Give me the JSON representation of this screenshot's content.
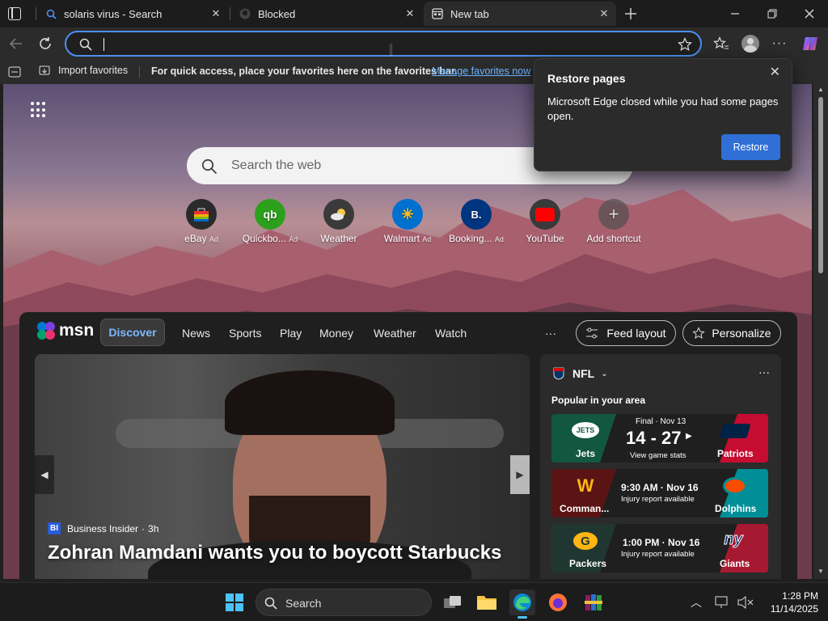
{
  "tabs": [
    {
      "title": "solaris virus - Search",
      "icon": "bing-search-icon"
    },
    {
      "title": "Blocked",
      "icon": "github-icon"
    },
    {
      "title": "New tab",
      "icon": "new-tab-page-icon"
    }
  ],
  "favorites_bar": {
    "import_label": "Import favorites",
    "prompt": "For quick access, place your favorites here on the favorites bar.",
    "manage_link": "Manage favorites now"
  },
  "search": {
    "placeholder": "Search the web"
  },
  "top_sites": [
    {
      "name": "eBay",
      "ad": "Ad"
    },
    {
      "name": "Quickbo...",
      "ad": "Ad"
    },
    {
      "name": "Weather",
      "ad": ""
    },
    {
      "name": "Walmart",
      "ad": "Ad"
    },
    {
      "name": "Booking...",
      "ad": "Ad"
    },
    {
      "name": "YouTube",
      "ad": ""
    },
    {
      "name": "Add shortcut",
      "ad": ""
    }
  ],
  "feed_nav": {
    "brand": "msn",
    "items": [
      "Discover",
      "News",
      "Sports",
      "Play",
      "Money",
      "Weather",
      "Watch"
    ],
    "more": "···",
    "feed_layout": "Feed layout",
    "personalize": "Personalize"
  },
  "hero": {
    "source": "Business Insider",
    "source_badge": "BI",
    "age": "3h",
    "headline": "Zohran Mamdani wants you to boycott Starbucks"
  },
  "nfl": {
    "title": "NFL",
    "subtitle": "Popular in your area",
    "games": [
      {
        "home": "Jets",
        "away": "Patriots",
        "status": "Final · Nov 13",
        "score": "14 - 27",
        "detail": "View game stats",
        "home_color": "#125740",
        "away_color": "#c60c30"
      },
      {
        "home": "Comman...",
        "away": "Dolphins",
        "status": "9:30 AM · Nov 16",
        "score": "",
        "detail": "Injury report available",
        "home_color": "#5a1414",
        "away_color": "#008e97"
      },
      {
        "home": "Packers",
        "away": "Giants",
        "status": "1:00 PM · Nov 16",
        "score": "",
        "detail": "Injury report available",
        "home_color": "#203731",
        "away_color": "#a71930"
      }
    ]
  },
  "restore_dialog": {
    "title": "Restore pages",
    "body": "Microsoft Edge closed while you had some pages open.",
    "button": "Restore"
  },
  "taskbar": {
    "search_label": "Search",
    "time": "1:28 PM",
    "date": "11/14/2025"
  },
  "colors": {
    "accent": "#4c90f0",
    "restore_button": "#2f6fd6",
    "link": "#6cb4ff"
  }
}
